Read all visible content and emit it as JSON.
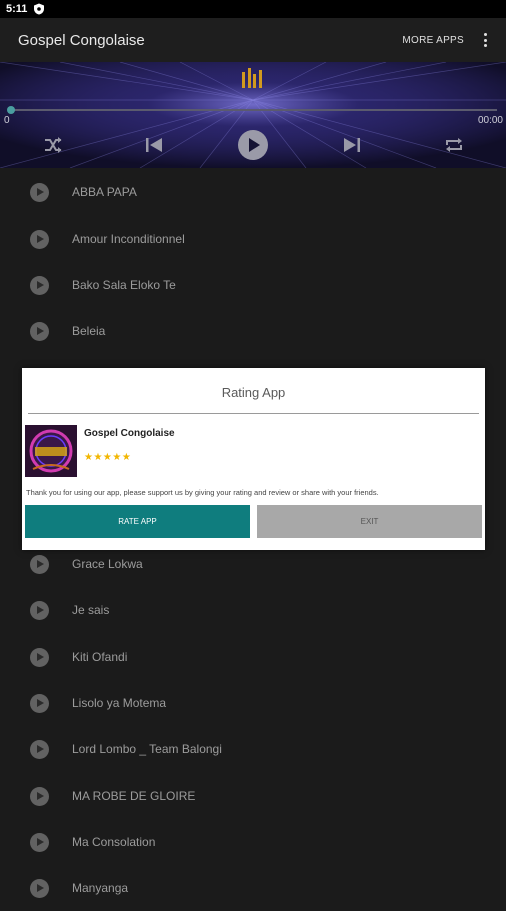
{
  "status": {
    "time": "5:11"
  },
  "appbar": {
    "title": "Gospel Congolaise",
    "more_apps": "MORE APPS"
  },
  "player": {
    "elapsed": "0",
    "duration": "00:00",
    "progress": 0
  },
  "songs": [
    "ABBA PAPA",
    "Amour Inconditionnel",
    "Bako Sala Eloko Te",
    "Beleia",
    "Grace Lokwa",
    "Je sais",
    "Kiti Ofandi",
    "Lisolo ya Motema",
    "Lord Lombo _ Team Balongi",
    "MA ROBE DE GLOIRE",
    "Ma Consolation",
    "Manyanga"
  ],
  "dialog": {
    "title": "Rating App",
    "app_name": "Gospel Congolaise",
    "stars": "★★★★★",
    "rating": 4.5,
    "message": "Thank you for using our app, please support us by giving your rating and review or share with your friends.",
    "rate_label": "RATE APP",
    "exit_label": "EXIT",
    "icon_text": "GOSPEL CONGOLAISE"
  },
  "colors": {
    "accent": "#0f7d7e",
    "star": "#f2b600",
    "player_bg": "#151334"
  }
}
